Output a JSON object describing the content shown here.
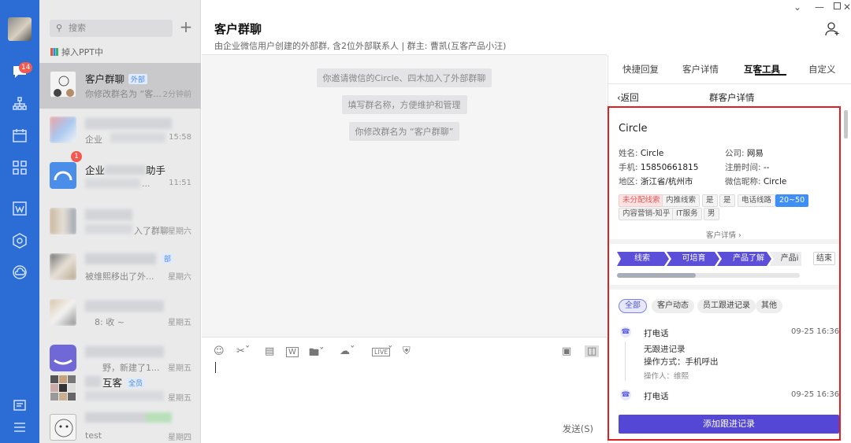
{
  "rail": {
    "badge": "14"
  },
  "list": {
    "search_placeholder": "搜索",
    "banner": "掉入PPT中",
    "conversations": [
      {
        "name": "客户群聊",
        "tag": "外部",
        "preview": "你修改群名为 “客...",
        "time": "2分钟前"
      },
      {
        "name": "",
        "preview": "企业",
        "time": "15:58"
      },
      {
        "name": "企业",
        "name_suffix": "助手",
        "preview": "...",
        "time": "11:51",
        "badge": "1"
      },
      {
        "name": "",
        "preview": "入了群聊",
        "time": "星期六"
      },
      {
        "name": "",
        "preview": "被维熙移出了外...",
        "time": "星期六",
        "tag": "部"
      },
      {
        "name": "",
        "preview": "8: 收 ~",
        "time": "星期五"
      },
      {
        "name": "",
        "preview": "野，新建了1...",
        "time": "星期五"
      },
      {
        "name": "互客",
        "tag": "全员",
        "preview": "",
        "time": "星期五"
      },
      {
        "name": "",
        "preview": "test",
        "time": "星期四"
      }
    ]
  },
  "chat": {
    "title": "客户群聊",
    "subtitle": "由企业微信用户创建的外部群, 含2位外部联系人 | 群主: 曹凯(互客产品小汪)",
    "system_messages": [
      "你邀请微信的Circle、四木加入了外部群聊",
      "填写群名称，方便维护和管理",
      "你修改群名为 “客户群聊”"
    ],
    "send_label": "发送(S)"
  },
  "panel": {
    "tabs": [
      "快捷回复",
      "客户详情",
      "互客工具",
      "自定义"
    ],
    "back_label": "返回",
    "title": "群客户详情",
    "customer": {
      "name": "Circle",
      "fields": [
        {
          "label": "姓名:",
          "value": "Circle"
        },
        {
          "label": "公司:",
          "value": "网易"
        },
        {
          "label": "手机:",
          "value": "15850661815"
        },
        {
          "label": "注册时间:",
          "value": "--"
        },
        {
          "label": "地区:",
          "value": "浙江省/杭州市"
        },
        {
          "label": "微信昵称:",
          "value": "Circle"
        }
      ],
      "tags_row1": [
        "未分配线索",
        "内推线索",
        "是",
        "是",
        "电话线路",
        "20~50"
      ],
      "tags_row2": [
        "内容营销-知乎",
        "IT服务",
        "男"
      ],
      "detail_link": "客户详情 ›"
    },
    "stages": [
      "线索",
      "可培育",
      "产品了解",
      "产品i"
    ],
    "end_label": "结束",
    "filters": [
      "全部",
      "客户动态",
      "员工跟进记录",
      "其他"
    ],
    "timeline": [
      {
        "title": "打电话",
        "time": "09-25 16:36",
        "lines": [
          "无跟进记录",
          "操作方式：手机呼出"
        ],
        "operator": "操作人：维熙"
      },
      {
        "title": "打电话",
        "time": "09-25 16:36"
      }
    ],
    "add_button": "添加跟进记录"
  },
  "colors": {
    "rail": "#2b6dd4",
    "accent": "#5447d6",
    "highlight_box": "#e02020"
  }
}
